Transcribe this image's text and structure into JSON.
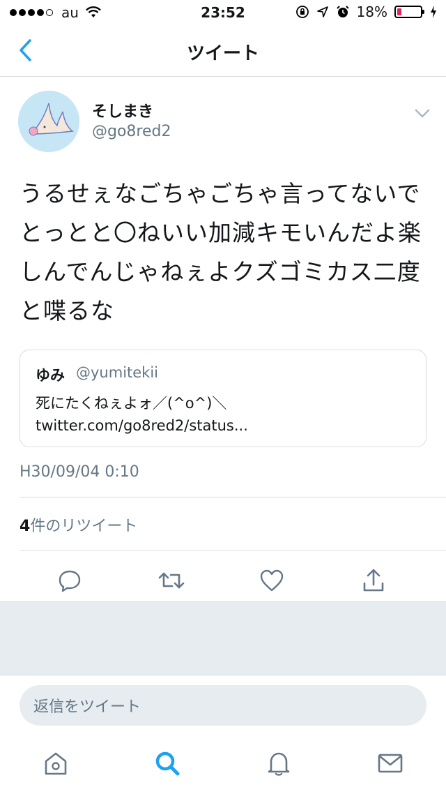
{
  "status_bar": {
    "carrier": "au",
    "time": "23:52",
    "battery_percent": "18%",
    "battery_level": 0.18,
    "signal_bars": 4,
    "signal_total": 5
  },
  "nav": {
    "title": "ツイート",
    "back_icon": "chevron-left-icon"
  },
  "tweet": {
    "display_name": "そしまき",
    "handle": "@go8red2",
    "text": "うるせぇなごちゃごちゃ言ってないでとっとと〇ねいい加減キモいんだよ楽しんでんじゃねぇよクズゴミカス二度と喋るな",
    "timestamp": "H30/09/04 0:10",
    "retweet_count": "4",
    "retweet_label": "件のリツイート"
  },
  "quote": {
    "name": "ゆみ",
    "handle": "@yumitekii",
    "text": "死にたくねぇよォ／(^o^)＼ twitter.com/go8red2/status..."
  },
  "reply": {
    "placeholder": "返信をツイート"
  },
  "colors": {
    "accent": "#1da1f2",
    "text": "#14171a",
    "secondary": "#657786",
    "divider": "#d8dde0",
    "gray_bg": "#e6ecf0",
    "battery_low": "#e0245e"
  },
  "tab_bar": {
    "items": [
      "home-icon",
      "search-icon",
      "notifications-icon",
      "messages-icon"
    ],
    "active": "search-icon"
  }
}
